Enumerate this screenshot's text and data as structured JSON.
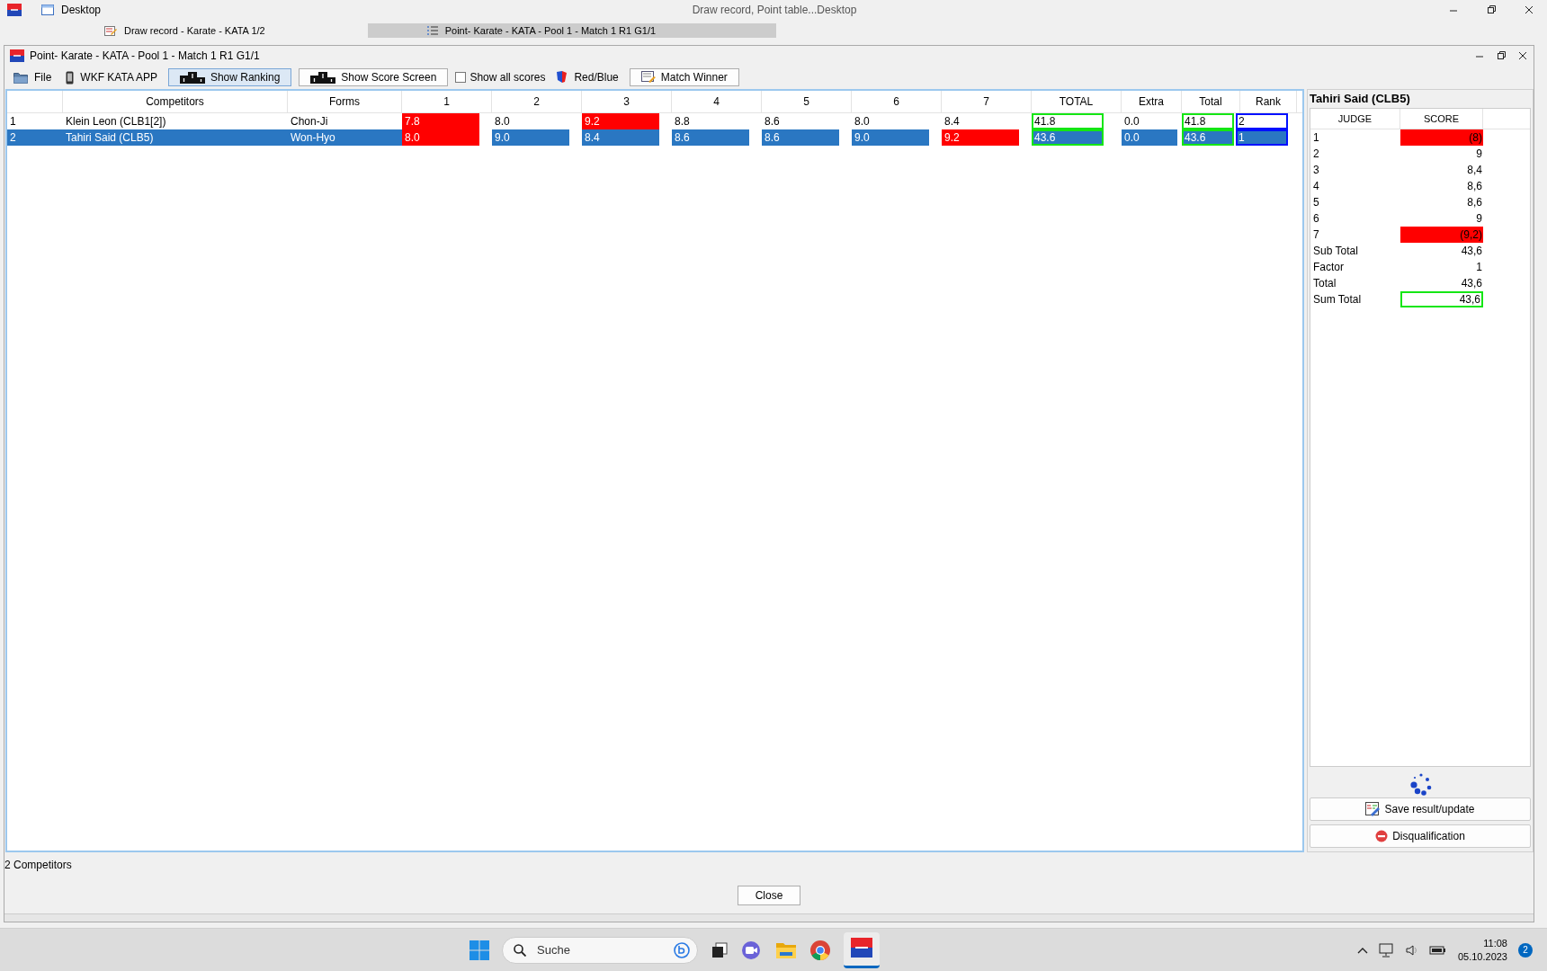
{
  "desktop": {
    "title": "Desktop",
    "center_title": "Draw record, Point table...Desktop",
    "tabs": [
      {
        "label": "Draw record - Karate - KATA 1/2",
        "selected": false
      },
      {
        "label": "Point- Karate - KATA - Pool 1 - Match 1 R1 G1/1",
        "selected": true
      }
    ]
  },
  "window": {
    "title": "Point- Karate - KATA - Pool 1 - Match 1 R1 G1/1"
  },
  "toolbar": [
    {
      "kind": "menu",
      "label": "File"
    },
    {
      "kind": "menu",
      "label": "WKF KATA APP"
    },
    {
      "kind": "button",
      "label": "Show Ranking",
      "selected": true
    },
    {
      "kind": "button",
      "label": "Show Score Screen",
      "selected": false
    },
    {
      "kind": "checkbox",
      "label": "Show all scores",
      "checked": false
    },
    {
      "kind": "menu",
      "label": "Red/Blue"
    },
    {
      "kind": "button",
      "label": "Match Winner",
      "selected": false
    }
  ],
  "grid": {
    "columns": [
      "Competitors",
      "Forms",
      "1",
      "2",
      "3",
      "4",
      "5",
      "6",
      "7",
      "TOTAL",
      "Extra",
      "Total",
      "Rank"
    ],
    "rows": [
      {
        "number": "1",
        "competitor": "Klein Leon (CLB1[2])",
        "form": "Chon-Ji",
        "scores": [
          {
            "value": "7.8",
            "excluded": true
          },
          {
            "value": "8.0",
            "excluded": false
          },
          {
            "value": "9.2",
            "excluded": true
          },
          {
            "value": "8.8",
            "excluded": false
          },
          {
            "value": "8.6",
            "excluded": false
          },
          {
            "value": "8.0",
            "excluded": false
          },
          {
            "value": "8.4",
            "excluded": false
          }
        ],
        "total": "41.8",
        "extra": "0.0",
        "sum": "41.8",
        "rank": "2",
        "selected": false
      },
      {
        "number": "2",
        "competitor": "Tahiri Said (CLB5)",
        "form": "Won-Hyo",
        "scores": [
          {
            "value": "8.0",
            "excluded": true
          },
          {
            "value": "9.0",
            "excluded": false
          },
          {
            "value": "8.4",
            "excluded": false
          },
          {
            "value": "8.6",
            "excluded": false
          },
          {
            "value": "8.6",
            "excluded": false
          },
          {
            "value": "9.0",
            "excluded": false
          },
          {
            "value": "9.2",
            "excluded": true
          }
        ],
        "total": "43.6",
        "extra": "0.0",
        "sum": "43.6",
        "rank": "1",
        "selected": true
      }
    ]
  },
  "panel": {
    "title": "Tahiri Said (CLB5)",
    "columns": [
      "JUDGE",
      "SCORE"
    ],
    "judges": [
      {
        "judge": "1",
        "score": "(8)",
        "excluded": true
      },
      {
        "judge": "2",
        "score": "9",
        "excluded": false
      },
      {
        "judge": "3",
        "score": "8,4",
        "excluded": false
      },
      {
        "judge": "4",
        "score": "8,6",
        "excluded": false
      },
      {
        "judge": "5",
        "score": "8,6",
        "excluded": false
      },
      {
        "judge": "6",
        "score": "9",
        "excluded": false
      },
      {
        "judge": "7",
        "score": "(9,2)",
        "excluded": true
      }
    ],
    "summary": [
      {
        "label": "Sub Total",
        "value": "43,6",
        "outlined": false
      },
      {
        "label": "Factor",
        "value": "1",
        "outlined": false
      },
      {
        "label": "Total",
        "value": "43,6",
        "outlined": false
      },
      {
        "label": "Sum Total",
        "value": "43,6",
        "outlined": true
      }
    ],
    "buttons": [
      "Save result/update",
      "Disqualification"
    ]
  },
  "status_bar": "2 Competitors",
  "close_button": "Close",
  "taskbar": {
    "search_placeholder": "Suche",
    "time": "11:08",
    "date": "05.10.2023",
    "notifications": "2"
  }
}
